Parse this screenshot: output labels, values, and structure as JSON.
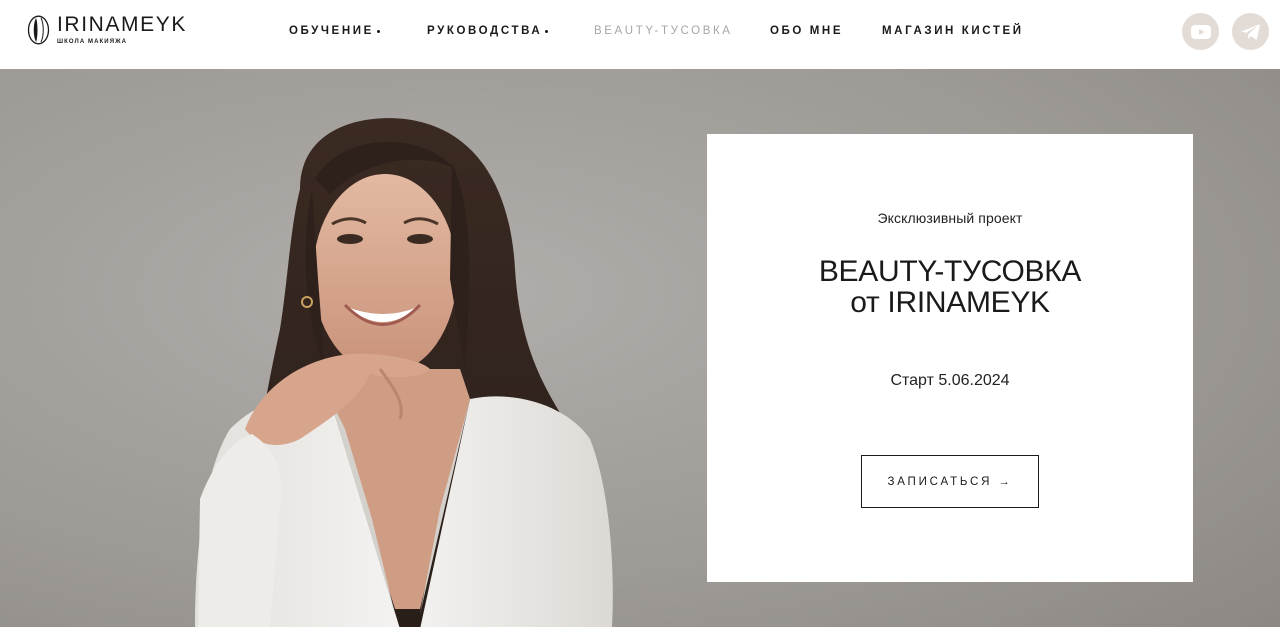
{
  "header": {
    "logo": {
      "title": "IRINAMEYK",
      "subtitle": "ШКОЛА МАКИЯЖА"
    },
    "nav": [
      {
        "label": "ОБУЧЕНИЕ",
        "has_dropdown": true
      },
      {
        "label": "РУКОВОДСТВА",
        "has_dropdown": true
      },
      {
        "label": "BEAUTY-ТУСОВКА",
        "active": true
      },
      {
        "label": "ОБО МНЕ"
      },
      {
        "label": "МАГАЗИН КИСТЕЙ"
      }
    ],
    "social": [
      {
        "name": "youtube-icon"
      },
      {
        "name": "telegram-icon"
      }
    ]
  },
  "hero": {
    "card": {
      "eyebrow": "Эксклюзивный проект",
      "title_line1": "BEAUTY-ТУСОВКА",
      "title_line2": "от IRINAMEYK",
      "date": "Старт 5.06.2024",
      "cta_label": "ЗАПИСАТЬСЯ →"
    }
  },
  "colors": {
    "nav_active": "#a6a6a6",
    "social_bg": "#e3dcd6",
    "hero_bg": "#9c9995",
    "text": "#1a1a1a"
  }
}
